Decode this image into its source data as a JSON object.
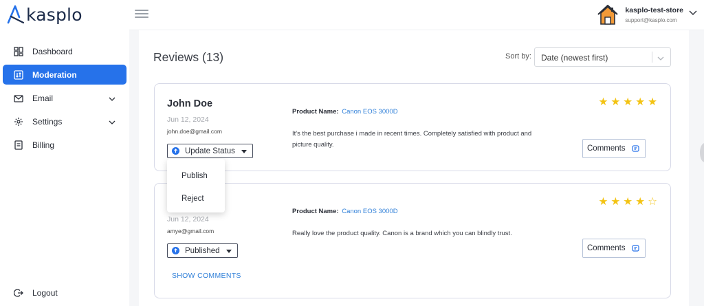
{
  "app": {
    "logo_text": "kasplo"
  },
  "sidebar": {
    "items": [
      {
        "label": "Dashboard",
        "icon": "dashboard-icon"
      },
      {
        "label": "Moderation",
        "icon": "moderation-icon",
        "active": true
      },
      {
        "label": "Email",
        "icon": "email-icon",
        "has_submenu": true
      },
      {
        "label": "Settings",
        "icon": "gear-icon",
        "has_submenu": true
      },
      {
        "label": "Billing",
        "icon": "billing-icon"
      }
    ],
    "logout_label": "Logout"
  },
  "header": {
    "store_name": "kasplo-test-store",
    "store_email": "support@kasplo.com"
  },
  "main": {
    "title": "Reviews (13)",
    "sort_label": "Sort by:",
    "sort_value": "Date (newest first)",
    "reviews": [
      {
        "name": "John Doe",
        "date": "Jun 12, 2024",
        "email": "john.doe@gmail.com",
        "status_label": "Update Status",
        "product_label": "Product Name:",
        "product_name": "Canon EOS 3000D",
        "text": "It's the best purchase i made in recent times. Completely satisfied with product and picture quality.",
        "rating": 5,
        "comments_label": "Comments"
      },
      {
        "name": "",
        "date": "Jun 12, 2024",
        "email": "amye@gmail.com",
        "status_label": "Published",
        "product_label": "Product Name:",
        "product_name": "Canon EOS 3000D",
        "text": "Really love the product quality. Canon is a brand which you can blindly trust.",
        "rating": 4,
        "comments_label": "Comments",
        "show_comments_label": "SHOW COMMENTS"
      }
    ],
    "status_menu": {
      "options": [
        "Publish",
        "Reject"
      ]
    }
  },
  "colors": {
    "accent": "#2672ea",
    "star": "#f3c313",
    "link": "#2f7fd8"
  }
}
